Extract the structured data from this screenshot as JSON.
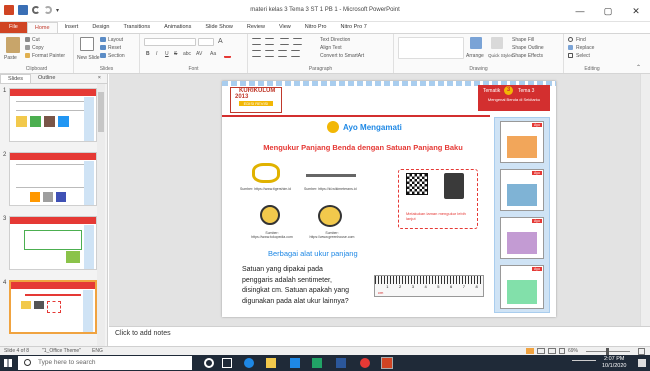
{
  "window": {
    "title": "materi kelas 3 Tema 3 ST 1 PB 1 - Microsoft PowerPoint",
    "min": "—",
    "max": "▢",
    "close": "✕"
  },
  "tabs": [
    "File",
    "Home",
    "Insert",
    "Design",
    "Transitions",
    "Animations",
    "Slide Show",
    "Review",
    "View",
    "Nitro Pro",
    "Nitro Pro 7"
  ],
  "ribbon": {
    "clipboard": {
      "label": "Clipboard",
      "paste": "Paste",
      "cut": "Cut",
      "copy": "Copy",
      "format_painter": "Format Painter"
    },
    "slides": {
      "label": "Slides",
      "new_slide": "New Slide",
      "layout": "Layout",
      "reset": "Reset",
      "section": "Section"
    },
    "font": {
      "label": "Font",
      "bold": "B",
      "italic": "I",
      "underline": "U",
      "strike": "S",
      "shadow": "abc",
      "font_a": "A",
      "spacing": "AV",
      "case": "Aa"
    },
    "paragraph": {
      "label": "Paragraph",
      "text_direction": "Text Direction",
      "align_text": "Align Text",
      "smartart": "Convert to SmartArt"
    },
    "drawing": {
      "label": "Drawing",
      "arrange": "Arrange",
      "quick_styles": "Quick Styles",
      "shape_fill": "Shape Fill",
      "shape_outline": "Shape Outline",
      "shape_effects": "Shape Effects"
    },
    "editing": {
      "label": "Editing",
      "find": "Find",
      "replace": "Replace",
      "select": "Select"
    }
  },
  "panel": {
    "tab_slides": "Slides",
    "tab_outline": "Outline",
    "close": "×",
    "slide_numbers": [
      "1",
      "2",
      "3",
      "4"
    ]
  },
  "slide": {
    "badge_tematik": "Tematik",
    "badge_tema": "Tema 3",
    "badge_num": "3",
    "badge_sub": "Mengenal Benda di Sekitarku",
    "kurikulum": "KURIKULUM",
    "kurikulum_year": "2013",
    "kurikulum_sub": "EDISI REVISI",
    "ayo": "Ayo Mengamati",
    "main_heading": "Mengukur Panjang Benda dengan Satuan Panjang Baku",
    "captions": [
      "Sumber: https://www.tigershim.id",
      "Sumber: https://id.wikimeterans.id",
      "Sumber: https://www.tokopedia.com",
      "Sumber: https://www.greenhouse.com"
    ],
    "qr_caption": "Melakukan laman mengukur lebih lanjut",
    "subheading": "Berbagai alat ukur panjang",
    "paragraph_lines": [
      "Satuan yang dipakai pada",
      "penggaris adalah sentimeter,",
      "disingkat cm. Satuan apakah yang",
      "digunakan pada alat ukur lainnya?"
    ],
    "ruler_numbers": [
      "1",
      "2",
      "3",
      "4",
      "5",
      "6",
      "7",
      "8"
    ],
    "ruler_unit": "cm",
    "side_tags": [
      "Ayo",
      "Ayo",
      "Ayo",
      "Ayo"
    ]
  },
  "notes": {
    "placeholder": "Click to add notes"
  },
  "status": {
    "slide_info": "Slide 4 of 8",
    "theme": "\"1_Office Theme\"",
    "lang": "ENG",
    "zoom": "69%"
  },
  "taskbar": {
    "search": "Type here to search",
    "time": "2:07 PM",
    "date": "10/1/2020"
  },
  "colors": {
    "accent": "#d04423",
    "slide_red": "#e53935",
    "slide_blue": "#1e88e5",
    "taskbar": "#1f2a38"
  }
}
